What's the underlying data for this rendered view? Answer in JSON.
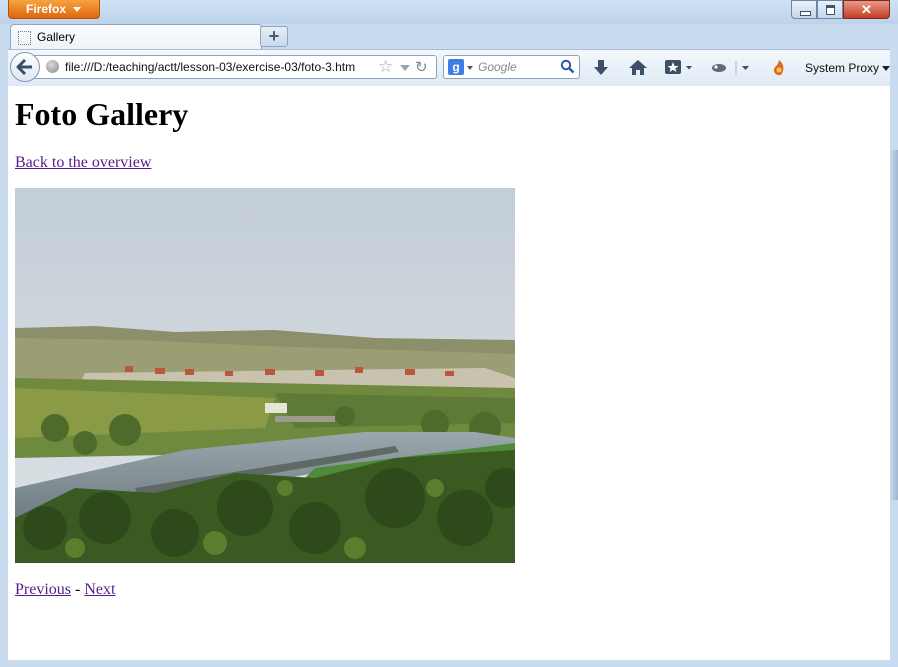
{
  "window": {
    "app_button": "Firefox",
    "controls": {
      "close_glyph": "✕"
    }
  },
  "tabs": [
    {
      "label": "Gallery",
      "active": true
    }
  ],
  "new_tab_glyph": "+",
  "navbar": {
    "url": "file:///D:/teaching/actt/lesson-03/exercise-03/foto-3.htm",
    "search_placeholder": "Google",
    "search_engine_letter": "g",
    "proxy_label": "System Proxy"
  },
  "page": {
    "title": "Foto Gallery",
    "back_link": "Back to the overview",
    "previous_link": "Previous",
    "separator": "-",
    "next_link": "Next",
    "photo_alt": "River valley with a lock, vineyards and a village"
  },
  "colors": {
    "visited_link": "#551a8b",
    "firefox_button": "#e0660e",
    "frame": "#c9dcef"
  }
}
